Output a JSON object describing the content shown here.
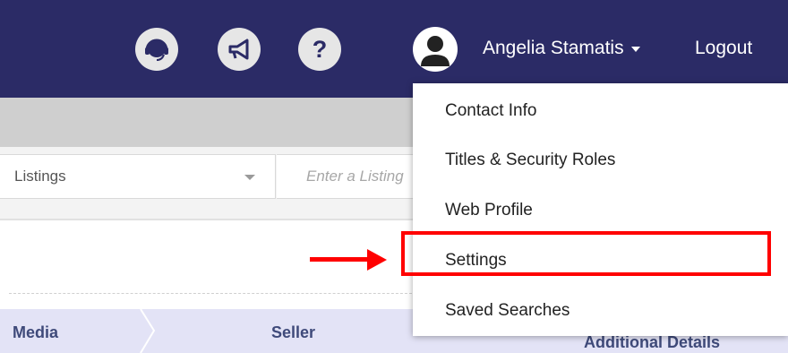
{
  "header": {
    "icons": {
      "support": "headset-icon",
      "announce": "megaphone-icon",
      "help": "help-icon",
      "avatar": "user-avatar-icon"
    },
    "help_glyph": "?",
    "user_name": "Angelia Stamatis",
    "logout_label": "Logout"
  },
  "search": {
    "dropdown_value": "Listings",
    "input_placeholder": "Enter a Listing"
  },
  "tabs": [
    "Media",
    "Seller",
    "Additional Details"
  ],
  "user_menu": {
    "items": [
      "Contact Info",
      "Titles & Security Roles",
      "Web Profile",
      "Settings",
      "Saved Searches"
    ],
    "highlighted": "Settings"
  },
  "colors": {
    "header_bg": "#2b2b66",
    "annotation": "#ff0000",
    "tab_bg": "#e3e3f6"
  }
}
